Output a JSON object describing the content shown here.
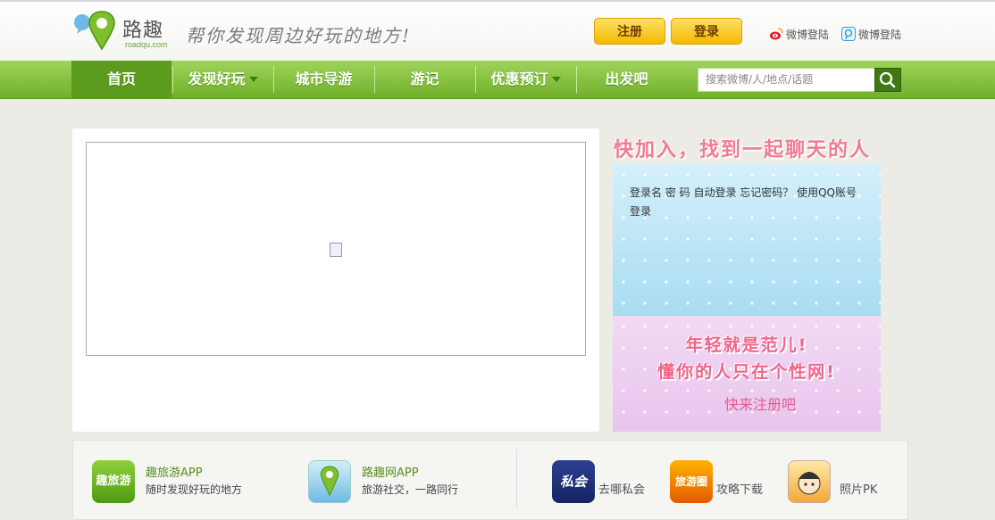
{
  "header": {
    "logo_text": "路趣",
    "logo_sub": "roadqu.com",
    "slogan": "帮你发现周边好玩的地方!",
    "register_label": "注册",
    "login_label": "登录",
    "weibo_login_1": "微博登陆",
    "weibo_login_2": "微博登陆"
  },
  "nav": {
    "items": [
      {
        "label": "首页"
      },
      {
        "label": "发现好玩"
      },
      {
        "label": "城市导游"
      },
      {
        "label": "游记"
      },
      {
        "label": "优惠预订"
      },
      {
        "label": "出发吧"
      }
    ],
    "search_placeholder": "搜索微博/人/地点/话题"
  },
  "side": {
    "title": "快加入，找到一起聊天的人",
    "login_text": "登录名 密 码 自动登录 忘记密码？ 使用QQ账号登录",
    "slogan_line1": "年轻就是范儿!",
    "slogan_line2": "懂你的人只在个性网!",
    "join_link": "快来注册吧"
  },
  "apps": {
    "app1": {
      "name": "趣旅游APP",
      "desc": "随时发现好玩的地方",
      "icon_text": "趣旅游"
    },
    "app2": {
      "name": "路趣网APP",
      "desc": "旅游社交，一路同行"
    },
    "small": [
      {
        "label": "去哪私会",
        "icon_text": "私会"
      },
      {
        "label": "攻略下载",
        "icon_text": "旅游圈"
      },
      {
        "label": "照片PK"
      }
    ]
  },
  "colors": {
    "brand_green": "#6fb02a",
    "button_yellow": "#f5b800",
    "accent_pink": "#f0648a"
  }
}
